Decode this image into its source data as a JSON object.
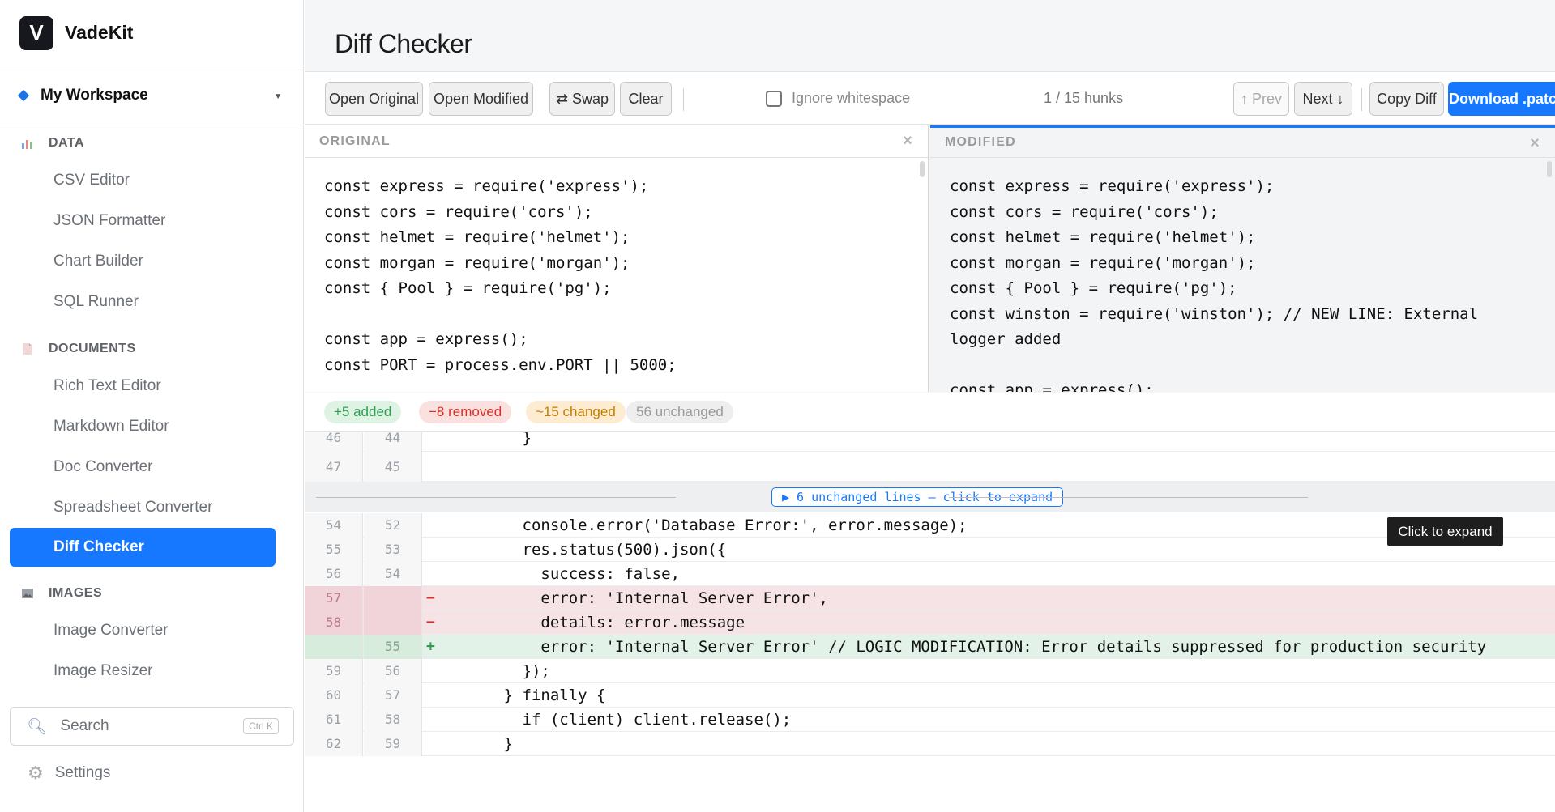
{
  "app": {
    "name": "VadeKit",
    "logo_letter": "V"
  },
  "workspace": {
    "name": "My Workspace"
  },
  "sidebar": {
    "sections": [
      {
        "label": "DATA",
        "icon": "bar-chart-icon",
        "items": [
          "CSV Editor",
          "JSON Formatter",
          "Chart Builder",
          "SQL Runner"
        ]
      },
      {
        "label": "DOCUMENTS",
        "icon": "document-icon",
        "items": [
          "Rich Text Editor",
          "Markdown Editor",
          "Doc Converter",
          "Spreadsheet Converter",
          "Diff Checker"
        ]
      },
      {
        "label": "IMAGES",
        "icon": "image-icon",
        "items": [
          "Image Converter",
          "Image Resizer"
        ]
      }
    ],
    "active_item": "Diff Checker",
    "search": {
      "placeholder": "Search",
      "shortcut": "Ctrl K"
    },
    "settings_label": "Settings"
  },
  "page": {
    "title": "Diff Checker"
  },
  "toolbar": {
    "open_original": "Open Original",
    "open_modified": "Open Modified",
    "swap": "⇄ Swap",
    "clear": "Clear",
    "ignore_whitespace": "Ignore whitespace",
    "hunks": "1 / 15 hunks",
    "prev": "↑ Prev",
    "next": "Next ↓",
    "copy_diff": "Copy Diff",
    "download": "Download .patch"
  },
  "original": {
    "header": "ORIGINAL",
    "code": "const express = require('express');\nconst cors = require('cors');\nconst helmet = require('helmet');\nconst morgan = require('morgan');\nconst { Pool } = require('pg');\n\nconst app = express();\nconst PORT = process.env.PORT || 5000;"
  },
  "modified": {
    "header": "MODIFIED",
    "code": "const express = require('express');\nconst cors = require('cors');\nconst helmet = require('helmet');\nconst morgan = require('morgan');\nconst { Pool } = require('pg');\nconst winston = require('winston'); // NEW LINE: External\nlogger added\n\nconst app = express();"
  },
  "stats": {
    "added": "+5 added",
    "removed": "−8 removed",
    "changed": "~15 changed",
    "unchanged": "56 unchanged"
  },
  "diff": {
    "top_rows": [
      {
        "a": "46",
        "b": "44",
        "text": "        }"
      },
      {
        "a": "47",
        "b": "45",
        "text": ""
      }
    ],
    "collapsed_label": "▶ 6 unchanged lines — click to expand",
    "tooltip": "Click to expand",
    "rows": [
      {
        "a": "54",
        "b": "52",
        "type": "ctx",
        "mark": "",
        "text": "        console.error('Database Error:', error.message);"
      },
      {
        "a": "55",
        "b": "53",
        "type": "ctx",
        "mark": "",
        "text": "        res.status(500).json({"
      },
      {
        "a": "56",
        "b": "54",
        "type": "ctx",
        "mark": "",
        "text": "          success: false,"
      },
      {
        "a": "57",
        "b": "",
        "type": "del",
        "mark": "−",
        "text": "          error: 'Internal Server Error',"
      },
      {
        "a": "58",
        "b": "",
        "type": "del",
        "mark": "−",
        "text": "          details: error.message"
      },
      {
        "a": "",
        "b": "55",
        "type": "add",
        "mark": "+",
        "text": "          error: 'Internal Server Error' // LOGIC MODIFICATION: Error details suppressed for production security"
      },
      {
        "a": "59",
        "b": "56",
        "type": "ctx",
        "mark": "",
        "text": "        });"
      },
      {
        "a": "60",
        "b": "57",
        "type": "ctx",
        "mark": "",
        "text": "      } finally {"
      },
      {
        "a": "61",
        "b": "58",
        "type": "ctx",
        "mark": "",
        "text": "        if (client) client.release();"
      },
      {
        "a": "62",
        "b": "59",
        "type": "ctx",
        "mark": "",
        "text": "      }"
      }
    ]
  },
  "colors": {
    "accent": "#1677ff",
    "added": "#2e9d4f",
    "removed": "#d93025",
    "changed": "#c77c00"
  }
}
